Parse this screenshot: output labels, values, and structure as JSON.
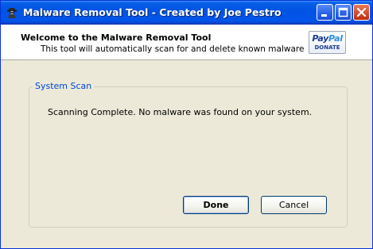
{
  "window": {
    "title": "Malware Removal Tool - Created by Joe Pestro",
    "icon": "spy-figure-icon",
    "controls": [
      "minimize-icon",
      "maximize-icon",
      "close-icon"
    ]
  },
  "header": {
    "title": "Welcome to the Malware Removal Tool",
    "subtitle": "This tool will automatically scan for and delete known malware",
    "paypal": {
      "logo_pay": "Pay",
      "logo_pal": "Pal",
      "donate_label": "DONATE"
    }
  },
  "scan": {
    "group_label": "System Scan",
    "status": "Scanning Complete. No malware was found on your system."
  },
  "buttons": {
    "done_label": "Done",
    "cancel_label": "Cancel"
  },
  "colors": {
    "titlebar": "#0054e3",
    "group_label": "#0046d5",
    "dialog_bg": "#ece9d8"
  }
}
